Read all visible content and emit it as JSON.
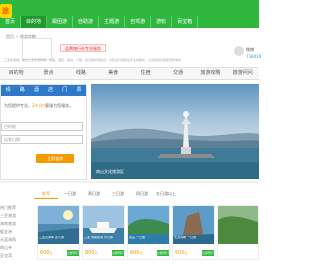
{
  "top_nav": {
    "logo_text": "途",
    "items": [
      "首页",
      "目的地",
      "跟团游",
      "自助游",
      "主题游",
      "自驾游",
      "游轮",
      "百宝箱"
    ]
  },
  "breadcrumb": [
    "首页",
    "旅游攻略"
  ],
  "header": {
    "badge_label": "品牌旅行社专业服务",
    "description": "三亚旅游网，提供三亚旅游攻略、线路、酒店、美食、门票、签证等旅游信息，为您出行提供最专业的服务，让您的旅途更加轻松愉快",
    "right_title": "微博",
    "right_number": "738419"
  },
  "category_nav": {
    "items": [
      "目的地",
      "景点",
      "线路",
      "美食",
      "住宿",
      "交通",
      "旅游攻略",
      "旅游问问"
    ]
  },
  "booking_panel": {
    "tabs": [
      "线",
      "路",
      "酒",
      "店",
      "门",
      "票"
    ],
    "line_prefix": "为您提供专业，",
    "line_highlight": "24小时",
    "line_suffix": "客服为您服务。",
    "input_1_placeholder": "目的地",
    "input_2_placeholder": "出发日期",
    "button_label": "立即查询"
  },
  "hero": {
    "caption": "南山文化旅游区"
  },
  "product_tabs": {
    "items": [
      "推荐",
      "一日游",
      "两日游",
      "三日游",
      "四日游",
      "五日游以上"
    ],
    "active": 0
  },
  "sidebar": {
    "items": [
      "热门推荐",
      "三亚旅游",
      "海南旅游",
      "蜈支洲",
      "天涯海角",
      "南山寺",
      "亚龙湾"
    ]
  },
  "cards": [
    {
      "caption": "三亚直通车 双人游",
      "price": "600",
      "unit": "元",
      "tag": "立即预订"
    },
    {
      "caption": "三亚 游艇出海 半日游",
      "price": "800",
      "unit": "元",
      "tag": "立即预订"
    },
    {
      "caption": "西岛 一日游",
      "price": "800",
      "unit": "元",
      "tag": "立即预订"
    },
    {
      "caption": "天涯海角 一日游",
      "price": "600",
      "unit": "元",
      "tag": "立即预订"
    }
  ],
  "colors": {
    "brand_green": "#2db83d",
    "accent_orange": "#f39a00",
    "panel_blue": "#2e79c9"
  }
}
